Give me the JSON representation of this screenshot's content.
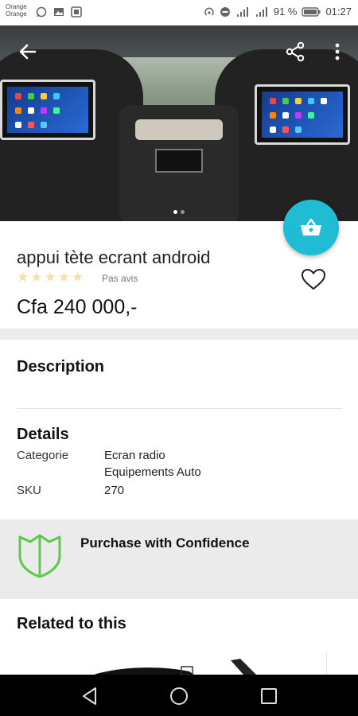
{
  "status_bar": {
    "carrier_line1": "Orange",
    "carrier_line2": "Orange",
    "battery": "91 %",
    "time": "01:27",
    "left_icons": [
      "whatsapp-icon",
      "image-icon",
      "screenshot-icon"
    ],
    "right_icons": [
      "hotspot-icon",
      "do-not-disturb-icon",
      "signal-icon",
      "signal-icon",
      "battery-icon"
    ]
  },
  "hero": {
    "image_dots": 2,
    "active_dot": 0,
    "icons": [
      "back-arrow-icon",
      "share-icon",
      "more-vertical-icon"
    ]
  },
  "product": {
    "title": "appui tète ecrant android",
    "rating_stars": 5,
    "rating_filled": 0,
    "reviews_label": "Pas avis",
    "price": "Cfa 240 000,-"
  },
  "sections": {
    "description_title": "Description",
    "details_title": "Details",
    "details": [
      {
        "label": "Categorie",
        "values": [
          "Ecran radio",
          "Equipements Auto"
        ]
      },
      {
        "label": "SKU",
        "values": [
          "270"
        ]
      }
    ],
    "confidence_title": "Purchase with Confidence",
    "related_title": "Related to this"
  },
  "colors": {
    "accent": "#1fbcd3",
    "shield_green": "#5cc94a",
    "star_empty": "#f7dfa6",
    "band_gray": "#ebebeb"
  },
  "navbar": {
    "icons": [
      "nav-back-icon",
      "nav-home-icon",
      "nav-recents-icon"
    ]
  }
}
